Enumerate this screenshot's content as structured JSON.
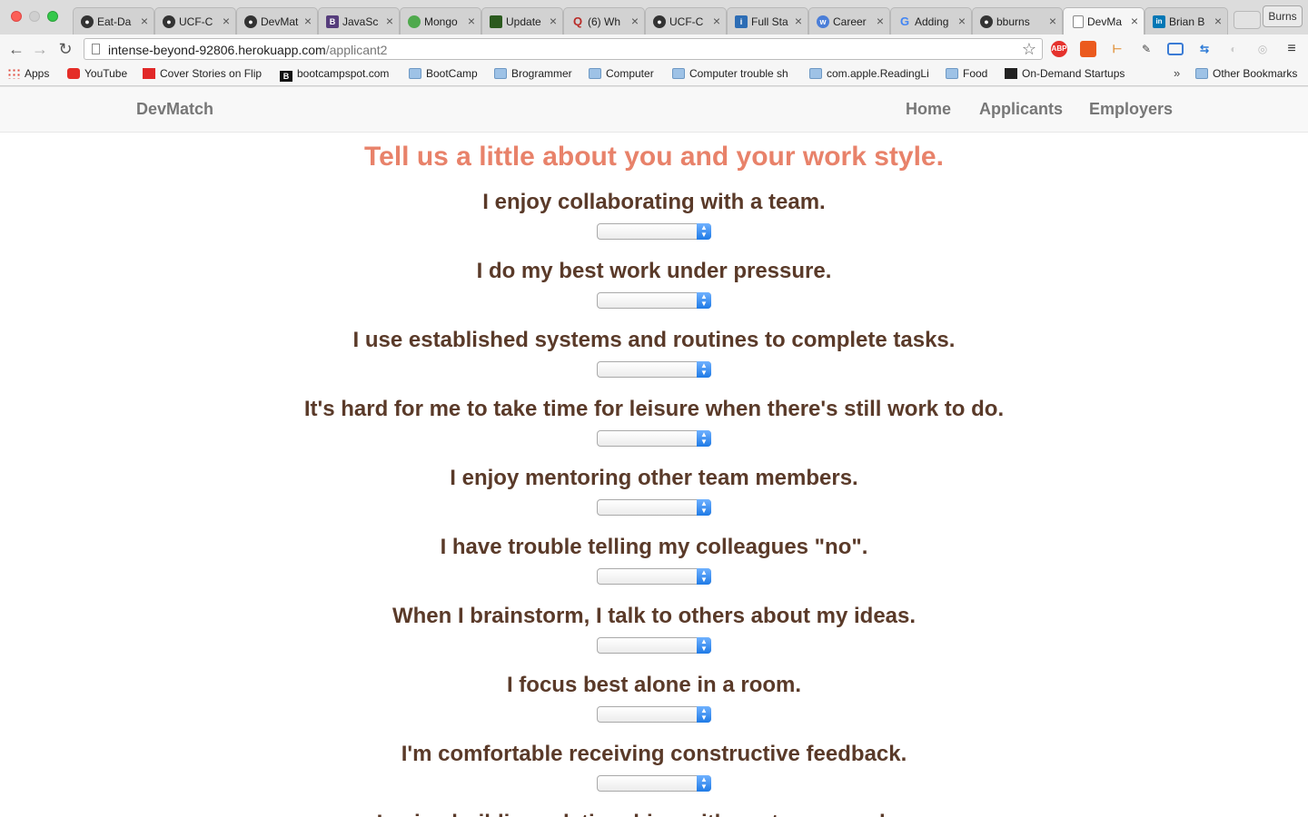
{
  "browser": {
    "tabs": [
      {
        "label": "Eat-Da",
        "icon": "github-icon"
      },
      {
        "label": "UCF-C",
        "icon": "github-icon"
      },
      {
        "label": "DevMat",
        "icon": "github-icon"
      },
      {
        "label": "JavaSc",
        "icon": "bootstrap-icon"
      },
      {
        "label": "Mongo",
        "icon": "mongodb-leaf-icon"
      },
      {
        "label": "Update",
        "icon": "update-icon"
      },
      {
        "label": "(6) Wh",
        "icon": "quora-icon"
      },
      {
        "label": "UCF-C",
        "icon": "github-icon"
      },
      {
        "label": "Full Sta",
        "icon": "info-icon"
      },
      {
        "label": "Career",
        "icon": "career-icon"
      },
      {
        "label": "Adding",
        "icon": "google-icon"
      },
      {
        "label": "bburns",
        "icon": "github-icon"
      },
      {
        "label": "DevMa",
        "icon": "page-icon"
      },
      {
        "label": "Brian B",
        "icon": "linkedin-icon"
      }
    ],
    "profile_name": "Burns",
    "url_host": "intense-beyond-92806.herokuapp.com",
    "url_path": "/applicant2",
    "bookmarks": [
      {
        "label": "Apps",
        "icon": "apps"
      },
      {
        "label": "YouTube",
        "icon": "yt"
      },
      {
        "label": "Cover Stories on Flip",
        "icon": "flip"
      },
      {
        "label": "bootcampspot.com",
        "icon": "bcs"
      },
      {
        "label": "BootCamp",
        "icon": "folder"
      },
      {
        "label": "Brogrammer",
        "icon": "folder"
      },
      {
        "label": "Computer",
        "icon": "folder"
      },
      {
        "label": "Computer trouble sh",
        "icon": "folder"
      },
      {
        "label": "com.apple.ReadingLi",
        "icon": "folder"
      },
      {
        "label": "Food",
        "icon": "folder"
      },
      {
        "label": "On-Demand Startups",
        "icon": "ods"
      }
    ],
    "bookmarks_more": "»",
    "other_bookmarks": "Other Bookmarks"
  },
  "navbar": {
    "brand": "DevMatch",
    "links": [
      "Home",
      "Applicants",
      "Employers"
    ]
  },
  "page": {
    "heading": "Tell us a little about you and your work style.",
    "questions": [
      "I enjoy collaborating with a team.",
      "I do my best work under pressure.",
      "I use established systems and routines to complete tasks.",
      "It's hard for me to take time for leisure when there's still work to do.",
      "I enjoy mentoring other team members.",
      "I have trouble telling my colleagues \"no\".",
      "When I brainstorm, I talk to others about my ideas.",
      "I focus best alone in a room.",
      "I'm comfortable receiving constructive feedback.",
      "I enjoy building relationships with my team members."
    ]
  },
  "colors": {
    "heading": "#e8826a",
    "question": "#5a3a29",
    "nav_text": "#777777"
  }
}
